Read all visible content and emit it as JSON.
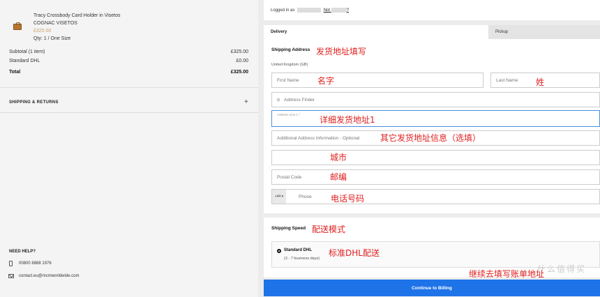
{
  "summary": {
    "product": {
      "name": "Tracy Crossbody Card Holder in Visetos",
      "brand": "COGNAC VISETOS",
      "price": "£325.00",
      "qty": "Qty: 1 / One Size"
    },
    "subtotal": {
      "label": "Subtotal (1 item)",
      "value": "£325.00"
    },
    "shipping": {
      "label": "Standard DHL",
      "value": "£0.00"
    },
    "total": {
      "label": "Total",
      "value": "£325.00"
    },
    "shipping_returns": "SHIPPING & RETURNS",
    "need_help": "NEED HELP?",
    "phone": "00800 8888 1976",
    "email": "contact.eu@mcmworldwide.com"
  },
  "account": {
    "logged_in_as": "Logged in as",
    "not_link": "Not",
    "not_suffix": "?"
  },
  "tabs": {
    "delivery": "Delivery",
    "pickup": "Pickup"
  },
  "shipping_address": {
    "title": "Shipping Address",
    "country": "United Kingdom (GB)",
    "first_name_placeholder": "First Name",
    "last_name_placeholder": "Last Name",
    "address_finder_placeholder": "Address Finder",
    "address_line1_label": "Address Line 1 *",
    "address_line2_placeholder": "Additional Address Information - Optional",
    "city_placeholder": "",
    "postal_code_placeholder": "Postal Code",
    "phone_prefix": "+44",
    "phone_placeholder": "Phone"
  },
  "shipping_speed": {
    "title": "Shipping Speed",
    "option_name": "Standard DHL",
    "option_days": "(3 - 7 business days)"
  },
  "continue_label": "Continue to Billing",
  "annotations": {
    "shipping_address": "发货地址填写",
    "first_name": "名字",
    "last_name": "姓",
    "address_line1": "详细发货地址1",
    "address_other": "其它发货地址信息（选填）",
    "city": "城市",
    "postal_code": "邮编",
    "phone": "电话号码",
    "shipping_mode": "配送模式",
    "standard_dhl": "标准DHL配送",
    "continue_billing": "继续去填写账单地址"
  },
  "watermark": "什么值得买",
  "colors": {
    "accent": "#1e73e8",
    "annotation": "#e02020",
    "price": "#c8a06a"
  }
}
